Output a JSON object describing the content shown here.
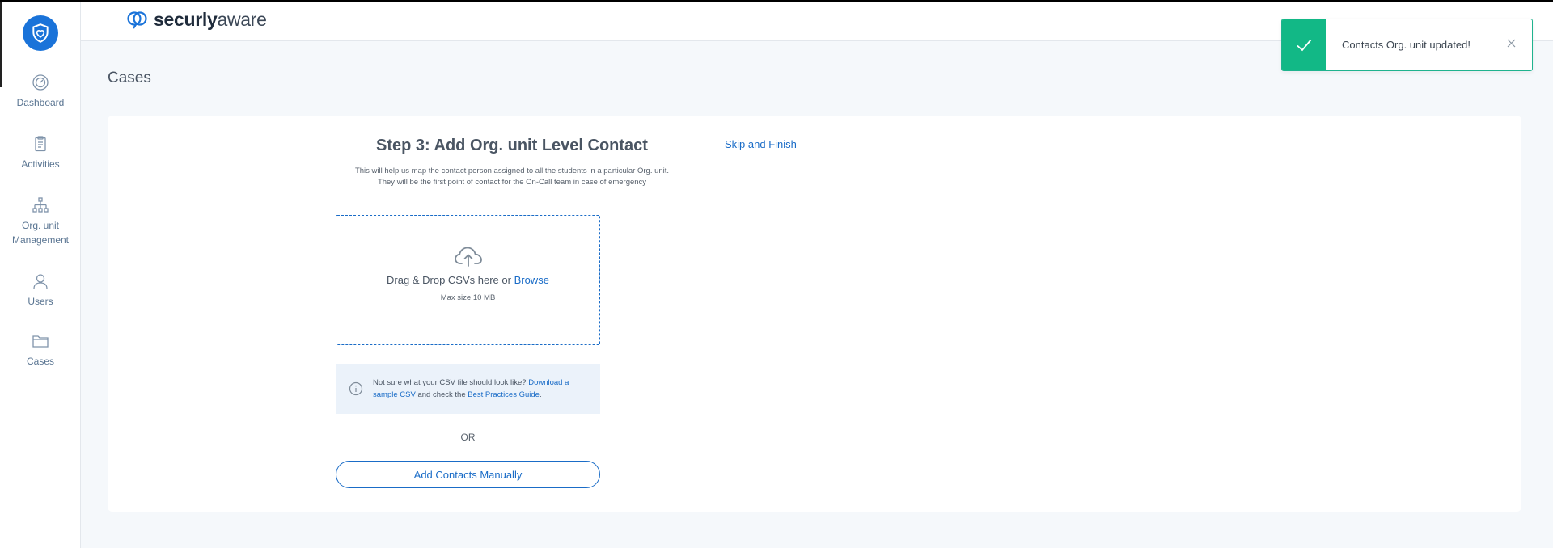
{
  "brand": {
    "logo_bold": "securly",
    "logo_light": "aware"
  },
  "sidebar": {
    "items": [
      {
        "label": "Dashboard",
        "icon": "gauge-icon"
      },
      {
        "label": "Activities",
        "icon": "clipboard-icon"
      },
      {
        "label": "Org. unit Management",
        "icon": "hierarchy-icon"
      },
      {
        "label": "Users",
        "icon": "user-icon"
      },
      {
        "label": "Cases",
        "icon": "folder-icon"
      }
    ]
  },
  "page": {
    "title": "Cases"
  },
  "step": {
    "title": "Step 3: Add Org. unit Level Contact",
    "desc_line1": "This will help us map the contact person assigned to all the students in a particular Org. unit.",
    "desc_line2": "They will be the first point of contact for the On-Call team in case of emergency",
    "skip_label": "Skip and Finish"
  },
  "dropzone": {
    "text": "Drag & Drop CSVs here or",
    "browse_label": "Browse",
    "max_size": "Max size 10 MB"
  },
  "info": {
    "text1": "Not sure what your CSV file should look like?",
    "link1": "Download a sample CSV",
    "text2": "and check the",
    "link2": "Best Practices Guide",
    "text3": "."
  },
  "or_label": "OR",
  "add_manual_label": "Add Contacts Manually",
  "toast": {
    "message": "Contacts Org. unit updated!"
  },
  "colors": {
    "accent": "#1a6cc7",
    "brand": "#1a73d9",
    "success": "#12b886"
  }
}
